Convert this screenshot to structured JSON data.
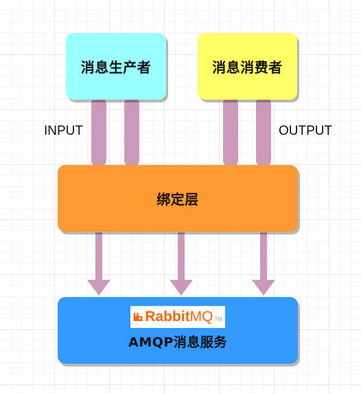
{
  "colors": {
    "producer": "#99ffff",
    "consumer": "#ffff66",
    "binding": "#ff9933",
    "amqp": "#3399ff",
    "pipe": "#cc99bb",
    "arrow": "#cc99bb"
  },
  "nodes": {
    "producer": {
      "label": "消息生产者"
    },
    "consumer": {
      "label": "消息消费者"
    },
    "binding": {
      "label": "绑定层"
    },
    "amqp": {
      "label": "AMQP消息服务",
      "logo": {
        "word": "RabbitMQ",
        "word_bold": "Rabbit",
        "word_light": "MQ",
        "mark": "TM",
        "icon": "rabbitmq-logo-icon"
      }
    }
  },
  "edge_labels": {
    "input": "INPUT",
    "output": "OUTPUT"
  },
  "edges": [
    {
      "from": "producer",
      "to": "binding",
      "kind": "pipe",
      "count": 2
    },
    {
      "from": "consumer",
      "to": "binding",
      "kind": "pipe",
      "count": 2
    },
    {
      "from": "binding",
      "to": "amqp",
      "kind": "arrow",
      "count": 3
    }
  ]
}
